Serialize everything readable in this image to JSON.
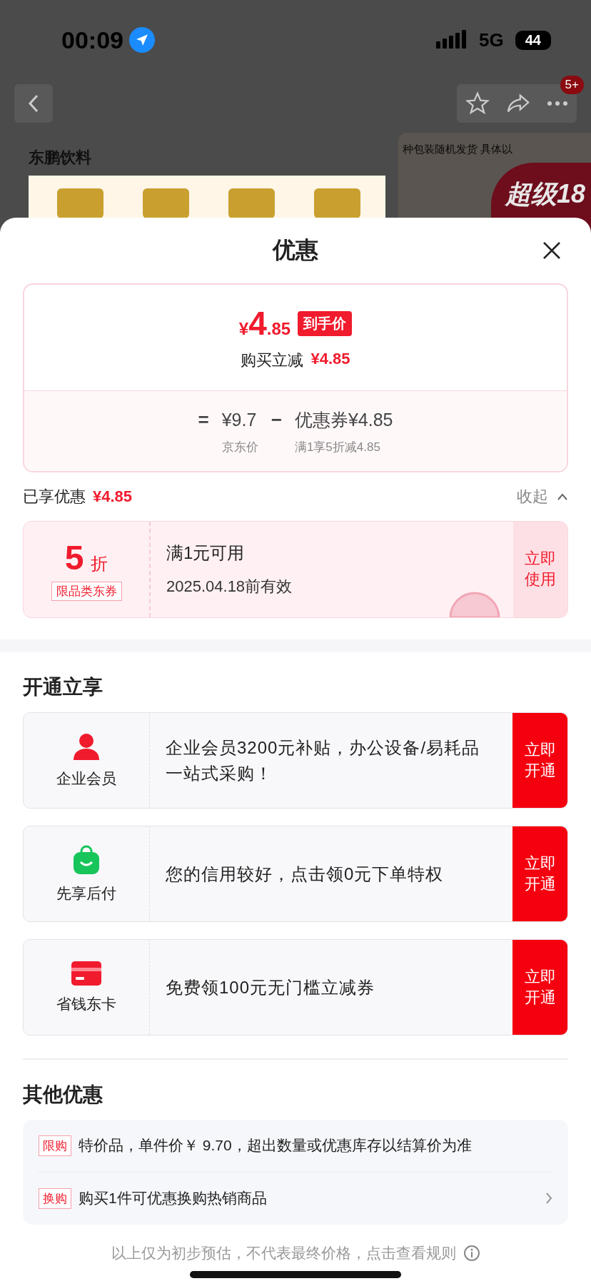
{
  "status_bar": {
    "time": "00:09",
    "network": "5G",
    "battery": "44"
  },
  "background_page": {
    "cart_badge": "5+",
    "brand": "东鹏饮料",
    "banner_text": "种包装随机发货 具体以",
    "promo_text": "超级18"
  },
  "sheet": {
    "title": "优惠",
    "price_card": {
      "currency": "¥",
      "price_int": "4",
      "price_dec": ".85",
      "price_tag": "到手价",
      "reduce_label": "购买立减",
      "reduce_value": "¥4.85",
      "equals": "=",
      "base_price": "¥9.7",
      "base_label": "京东价",
      "minus": "−",
      "coupon_part": "优惠券¥4.85",
      "coupon_desc": "满1享5折减4.85"
    },
    "enjoyed": {
      "label": "已享优惠",
      "value": "¥4.85",
      "toggle": "收起",
      "expanded": true
    },
    "coupons": [
      {
        "amount": "5",
        "unit": "折",
        "type_tag": "限品类东券",
        "condition": "满1元可用",
        "validity": "2025.04.18前有效",
        "action": "立即使用",
        "claimed": true
      }
    ],
    "open_section": {
      "title": "开通立享",
      "items": [
        {
          "kind": "member",
          "name": "企业会员",
          "desc": "企业会员3200元补贴，办公设备/易耗品一站式采购！",
          "action": "立即开通"
        },
        {
          "kind": "paylater",
          "name": "先享后付",
          "desc": "您的信用较好，点击领0元下单特权",
          "action": "立即开通"
        },
        {
          "kind": "card",
          "name": "省钱东卡",
          "desc": "免费领100元无门槛立减券",
          "action": "立即开通"
        }
      ]
    },
    "other_section": {
      "title": "其他优惠",
      "items": [
        {
          "tag": "限购",
          "text": "特价品，单件价￥ 9.70，超出数量或优惠库存以结算价为准",
          "has_arrow": false
        },
        {
          "tag": "换购",
          "text": "购买1件可优惠换购热销商品",
          "has_arrow": true
        }
      ]
    },
    "footer": "以上仅为初步预估，不代表最终价格，点击查看规则"
  }
}
